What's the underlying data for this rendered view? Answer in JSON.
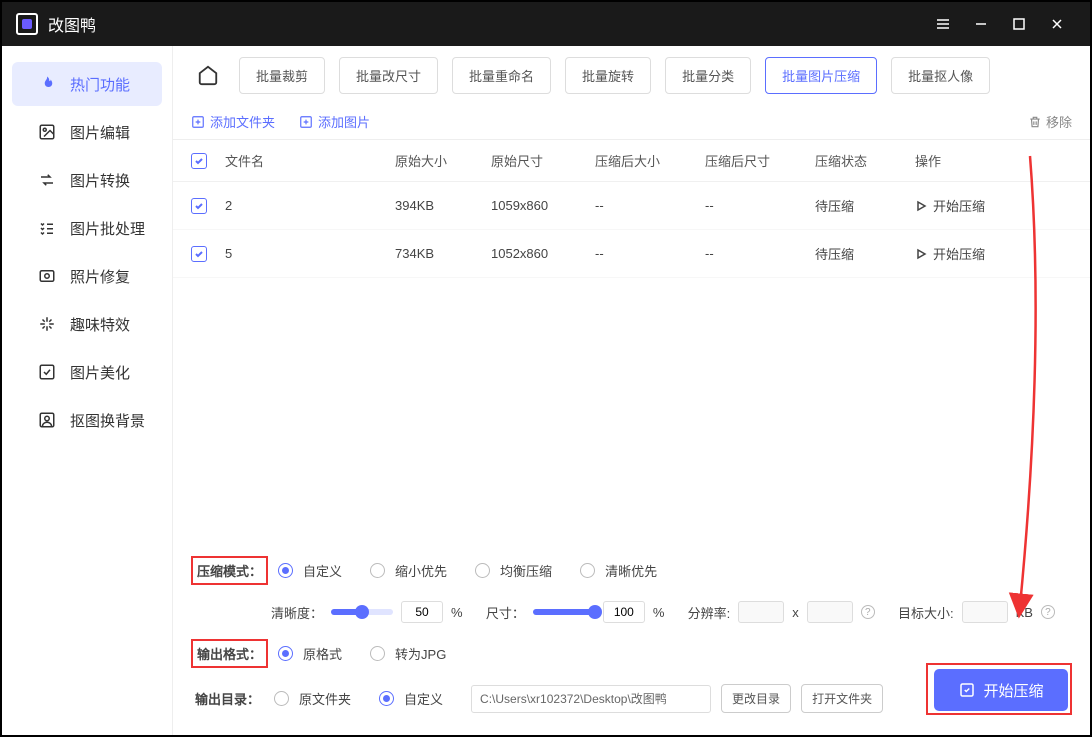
{
  "app": {
    "title": "改图鸭"
  },
  "sidebar": {
    "items": [
      {
        "label": "热门功能"
      },
      {
        "label": "图片编辑"
      },
      {
        "label": "图片转换"
      },
      {
        "label": "图片批处理"
      },
      {
        "label": "照片修复"
      },
      {
        "label": "趣味特效"
      },
      {
        "label": "图片美化"
      },
      {
        "label": "抠图换背景"
      }
    ]
  },
  "toolbar": {
    "items": [
      "批量裁剪",
      "批量改尺寸",
      "批量重命名",
      "批量旋转",
      "批量分类",
      "批量图片压缩",
      "批量抠人像"
    ]
  },
  "addRow": {
    "addFolder": "添加文件夹",
    "addImage": "添加图片",
    "remove": "移除"
  },
  "table": {
    "headers": {
      "name": "文件名",
      "size": "原始大小",
      "dim": "原始尺寸",
      "afterSize": "压缩后大小",
      "afterDim": "压缩后尺寸",
      "status": "压缩状态",
      "action": "操作"
    },
    "rows": [
      {
        "name": "2",
        "size": "394KB",
        "dim": "1059x860",
        "afterSize": "--",
        "afterDim": "--",
        "status": "待压缩",
        "action": "开始压缩"
      },
      {
        "name": "5",
        "size": "734KB",
        "dim": "1052x860",
        "afterSize": "--",
        "afterDim": "--",
        "status": "待压缩",
        "action": "开始压缩"
      }
    ]
  },
  "panel": {
    "mode": {
      "label": "压缩模式：",
      "opts": [
        "自定义",
        "缩小优先",
        "均衡压缩",
        "清晰优先"
      ]
    },
    "clarity": {
      "label": "清晰度：",
      "value": "50",
      "pct": "%"
    },
    "dim": {
      "label": "尺寸：",
      "value": "100",
      "pct": "%"
    },
    "res": {
      "label": "分辨率:",
      "x": "x"
    },
    "target": {
      "label": "目标大小:",
      "unit": "KB"
    },
    "format": {
      "label": "输出格式：",
      "opts": [
        "原格式",
        "转为JPG"
      ]
    },
    "output": {
      "label": "输出目录：",
      "opts": [
        "原文件夹",
        "自定义"
      ],
      "path": "C:\\Users\\xr102372\\Desktop\\改图鸭",
      "change": "更改目录",
      "open": "打开文件夹"
    },
    "start": "开始压缩"
  }
}
